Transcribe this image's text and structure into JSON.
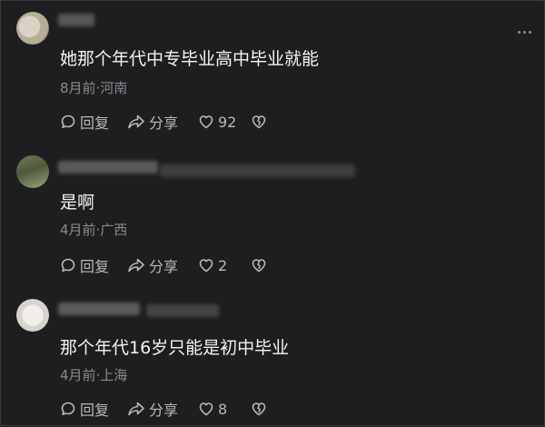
{
  "comments": [
    {
      "text": "她那个年代中专毕业高中毕业就能",
      "meta": "8月前·河南",
      "reply_label": "回复",
      "share_label": "分享",
      "like_count": "92"
    },
    {
      "text": "是啊",
      "meta": "4月前·广西",
      "reply_label": "回复",
      "share_label": "分享",
      "like_count": "2"
    },
    {
      "text": "那个年代16岁只能是初中毕业",
      "meta": "4月前·上海",
      "reply_label": "回复",
      "share_label": "分享",
      "like_count": "8"
    }
  ],
  "icons": {
    "reply": "reply-bubble-icon",
    "share": "share-arrow-icon",
    "like": "heart-icon",
    "dislike": "broken-heart-icon",
    "more": "more-dots-icon"
  },
  "colors": {
    "background": "#1e1e20",
    "text": "#f4f4f4",
    "meta": "#8a8a8e",
    "action": "#b9b9bc"
  }
}
